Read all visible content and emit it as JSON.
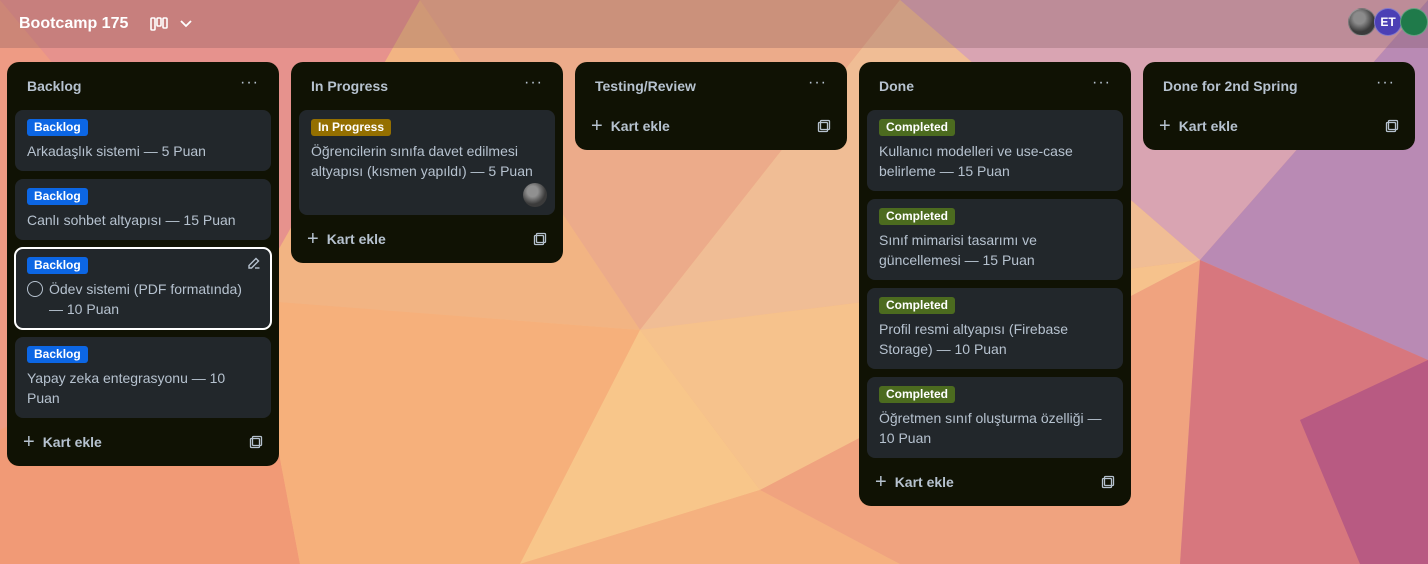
{
  "board": {
    "title": "Bootcamp 175"
  },
  "avatars": [
    {
      "initials": ""
    },
    {
      "initials": "ET"
    },
    {
      "initials": ""
    }
  ],
  "lists": [
    {
      "title": "Backlog",
      "cards": [
        {
          "label": "Backlog",
          "title": "Arkadaşlık sistemi — 5 Puan"
        },
        {
          "label": "Backlog",
          "title": "Canlı sohbet altyapısı — 15 Puan"
        },
        {
          "label": "Backlog",
          "title": "Ödev sistemi (PDF formatında) — 10 Puan"
        },
        {
          "label": "Backlog",
          "title": "Yapay zeka entegrasyonu — 10 Puan"
        }
      ],
      "add_label": "Kart ekle"
    },
    {
      "title": "In Progress",
      "cards": [
        {
          "label": "In Progress",
          "title": "Öğrencilerin sınıfa davet edilmesi altyapısı (kısmen yapıldı) — 5 Puan"
        }
      ],
      "add_label": "Kart ekle"
    },
    {
      "title": "Testing/Review",
      "cards": [],
      "add_label": "Kart ekle"
    },
    {
      "title": "Done",
      "cards": [
        {
          "label": "Completed",
          "title": "Kullanıcı modelleri ve use-case belirleme — 15 Puan"
        },
        {
          "label": "Completed",
          "title": "Sınıf mimarisi tasarımı ve güncellemesi — 15 Puan"
        },
        {
          "label": "Completed",
          "title": "Profil resmi altyapısı (Firebase Storage) — 10 Puan"
        },
        {
          "label": "Completed",
          "title": "Öğretmen sınıf oluşturma özelliği — 10 Puan"
        }
      ],
      "add_label": "Kart ekle"
    },
    {
      "title": "Done for 2nd Spring",
      "cards": [],
      "add_label": "Kart ekle"
    }
  ],
  "colors": {
    "backlog_label": "#0c66e4",
    "progress_label": "#946f00",
    "completed_label": "#4c6b1f",
    "list_bg": "#101204",
    "card_bg": "#22272b"
  },
  "icons": {
    "view": "board-view-icon",
    "chevron": "chevron-down-icon",
    "menu": "more-icon",
    "edit": "edit-icon",
    "add": "plus-icon",
    "template": "template-icon"
  }
}
